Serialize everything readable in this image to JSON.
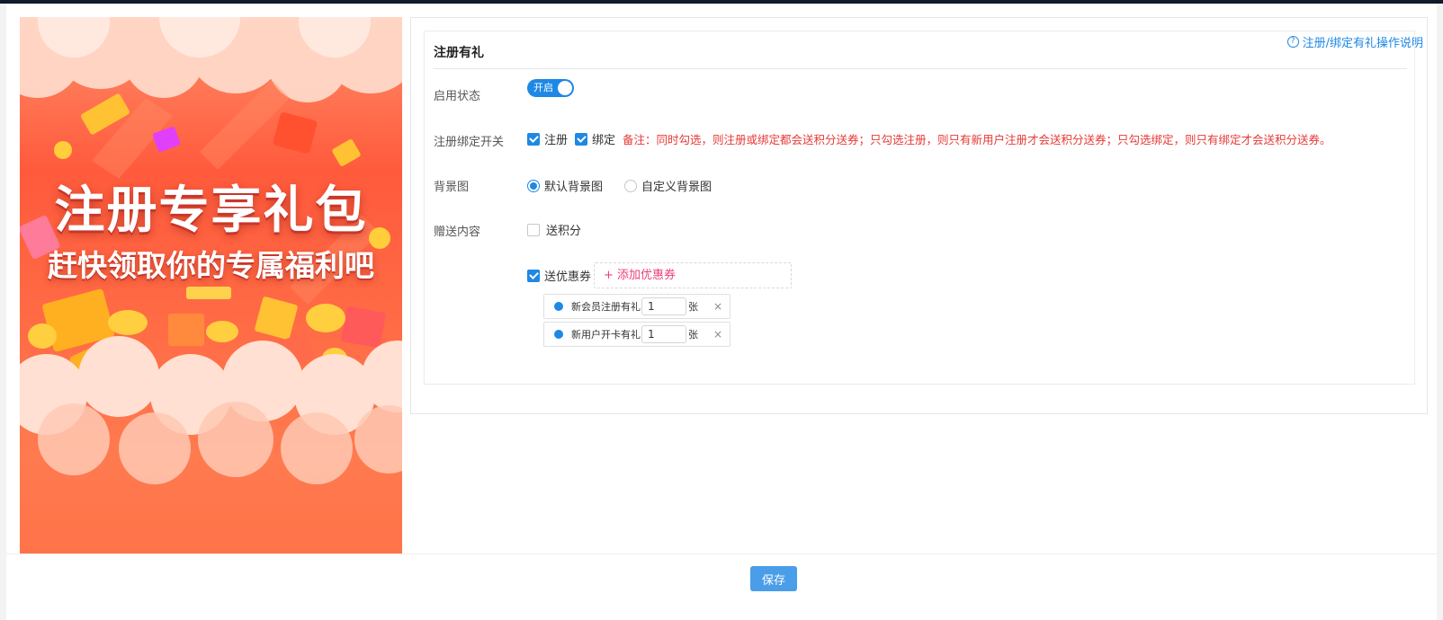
{
  "poster": {
    "title": "注册专享礼包",
    "subtitle": "赶快领取你的专属福利吧"
  },
  "help": {
    "label": "注册/绑定有礼操作说明",
    "icon": "question-circle-icon"
  },
  "section": {
    "title": "注册有礼"
  },
  "enable": {
    "label": "启用状态",
    "switch_text": "开启",
    "on": true
  },
  "bind_switch": {
    "label": "注册绑定开关",
    "register_label": "注册",
    "register_checked": true,
    "bind_label": "绑定",
    "bind_checked": true,
    "note": "备注：同时勾选，则注册或绑定都会送积分送券；只勾选注册，则只有新用户注册才会送积分送券；只勾选绑定，则只有绑定才会送积分送券。"
  },
  "background": {
    "label": "背景图",
    "options": [
      {
        "label": "默认背景图",
        "checked": true
      },
      {
        "label": "自定义背景图",
        "checked": false
      }
    ]
  },
  "gift": {
    "label": "赠送内容",
    "points_label": "送积分",
    "points_checked": false,
    "coupon_label": "送优惠券",
    "coupon_checked": true,
    "add_coupon_label": "+ 添加优惠券",
    "coupons": [
      {
        "name": "新会员注册有礼",
        "qty": "1",
        "unit": "张",
        "close": "×"
      },
      {
        "name": "新用户开卡有礼",
        "qty": "1",
        "unit": "张",
        "close": "×"
      }
    ]
  },
  "footer": {
    "save_label": "保存"
  },
  "colors": {
    "primary": "#1e88e5",
    "note": "#e53935",
    "add_coupon": "#ec407a",
    "poster_base": "#ff6b45"
  }
}
